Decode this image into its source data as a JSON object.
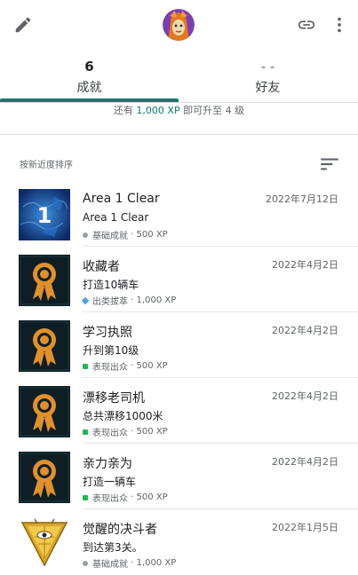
{
  "header": {
    "edit_icon": "pencil-icon",
    "link_icon": "link-icon",
    "more_icon": "more-vert-icon"
  },
  "tabs": [
    {
      "count": "6",
      "label": "成就"
    },
    {
      "count": "- -",
      "label": "好友"
    }
  ],
  "progress": {
    "prefix": "还有 ",
    "xp": "1,000 XP",
    "suffix": " 即可升至 4 级"
  },
  "sort": {
    "label": "按新近度排序",
    "icon": "sort-icon"
  },
  "achievements": [
    {
      "title": "Area 1 Clear",
      "desc": "Area 1 Clear",
      "rarity": "基础成就",
      "xp": "500 XP",
      "date": "2022年7月12日",
      "rarity_type": "grey",
      "thumb": "area-1-badge"
    },
    {
      "title": "收藏者",
      "desc": "打造10辆车",
      "rarity": "出类拔萃",
      "xp": "1,000 XP",
      "date": "2022年4月2日",
      "rarity_type": "blue",
      "thumb": "ribbon-medal"
    },
    {
      "title": "学习执照",
      "desc": "升到第10级",
      "rarity": "表现出众",
      "xp": "500 XP",
      "date": "2022年4月2日",
      "rarity_type": "green",
      "thumb": "ribbon-medal"
    },
    {
      "title": "漂移老司机",
      "desc": "总共漂移1000米",
      "rarity": "表现出众",
      "xp": "500 XP",
      "date": "2022年4月2日",
      "rarity_type": "green",
      "thumb": "ribbon-medal"
    },
    {
      "title": "亲力亲为",
      "desc": "打造一辆车",
      "rarity": "表现出众",
      "xp": "500 XP",
      "date": "2022年4月2日",
      "rarity_type": "green",
      "thumb": "ribbon-medal"
    },
    {
      "title": "觉醒的决斗者",
      "desc": "到达第3关。",
      "rarity": "基础成就",
      "xp": "1,000 XP",
      "date": "2022年1月5日",
      "rarity_type": "grey",
      "thumb": "millennium-puzzle"
    }
  ]
}
